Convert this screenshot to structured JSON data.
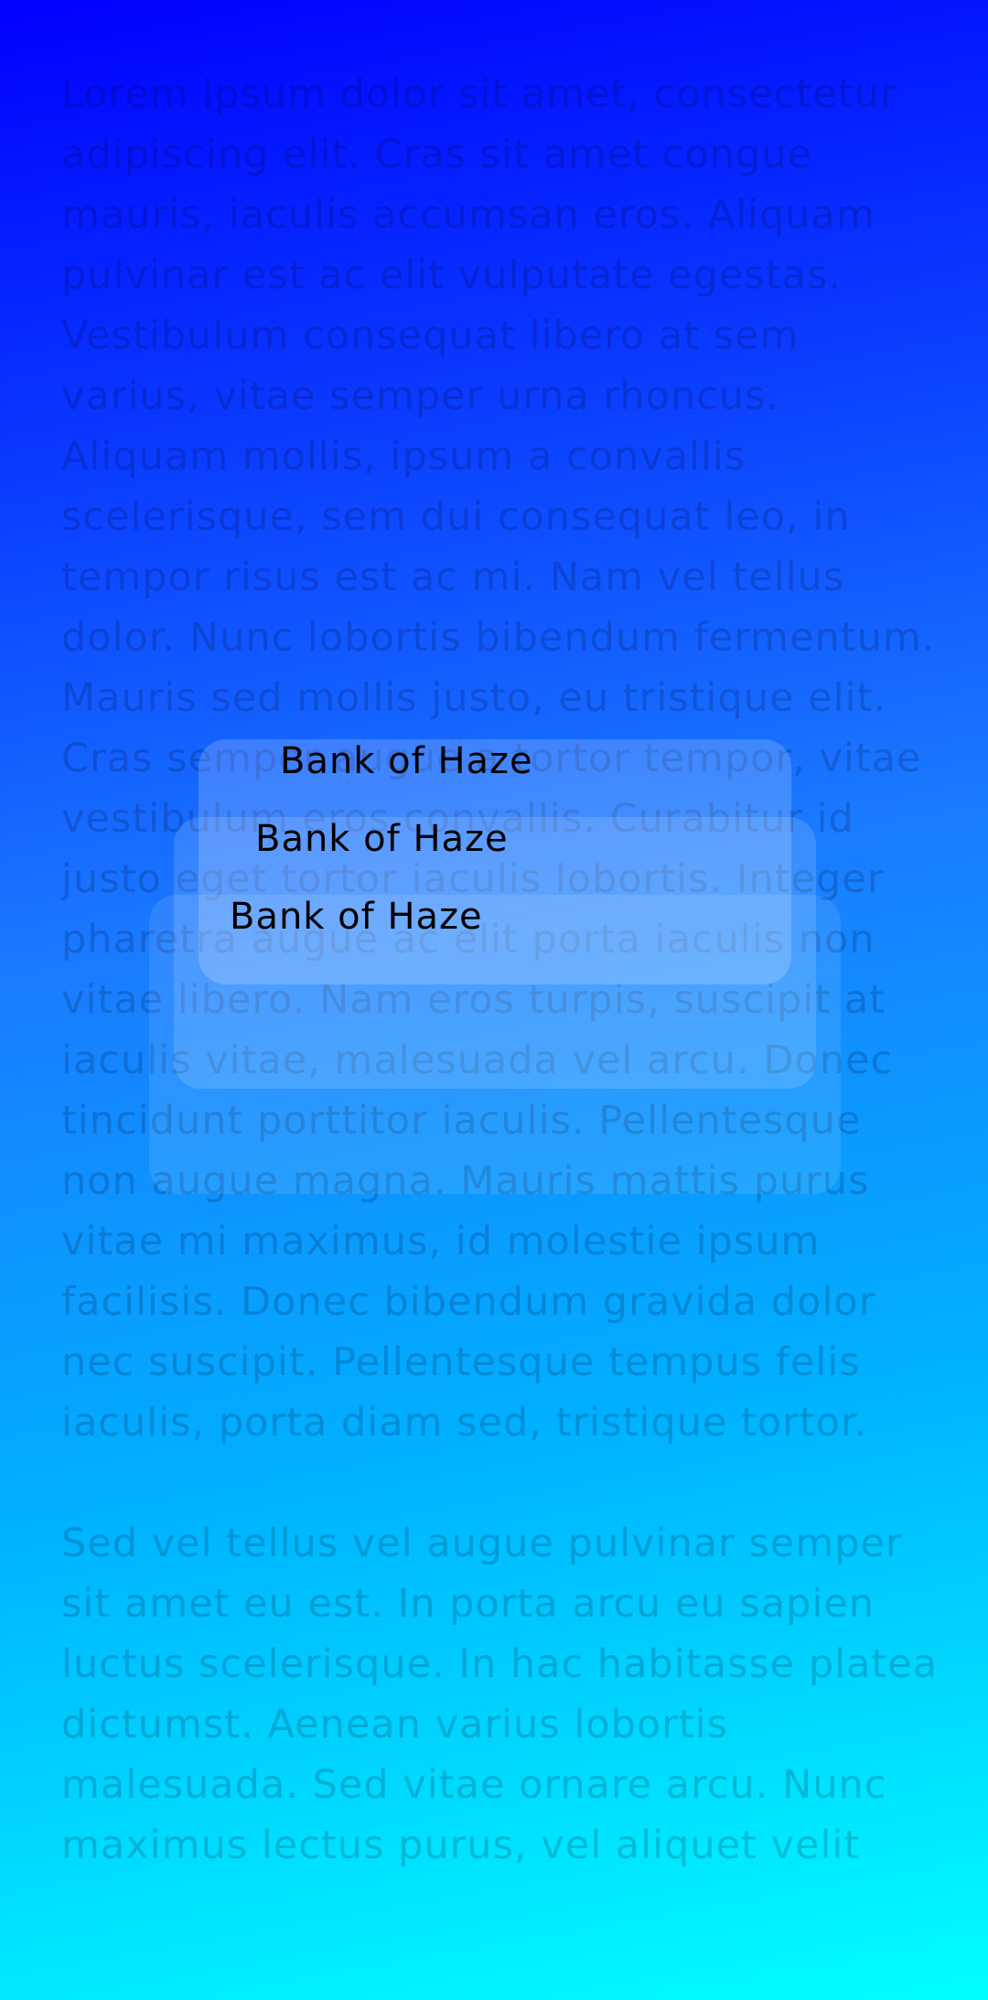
{
  "background": {
    "paragraphs": [
      "Lorem ipsum dolor sit amet, consectetur adipiscing elit. Cras sit amet congue mauris, iaculis accumsan eros. Aliquam pulvinar est ac elit vulputate egestas. Vestibulum consequat libero at sem varius, vitae semper urna rhoncus. Aliquam mollis, ipsum a convallis scelerisque, sem dui consequat leo, in tempor risus est ac mi. Nam vel tellus dolor. Nunc lobortis bibendum fermentum. Mauris sed mollis justo, eu tristique elit. Cras semper augue a tortor tempor, vitae vestibulum eros convallis. Curabitur id justo eget tortor iaculis lobortis. Integer pharetra augue ac elit porta iaculis non vitae libero. Nam eros turpis, suscipit at iaculis vitae, malesuada vel arcu. Donec tincidunt porttitor iaculis. Pellentesque non augue magna. Mauris mattis purus vitae mi maximus, id molestie ipsum facilisis. Donec bibendum gravida dolor nec suscipit. Pellentesque tempus felis iaculis, porta diam sed, tristique tortor.",
      "Sed vel tellus vel augue pulvinar semper sit amet eu est. In porta arcu eu sapien luctus scelerisque. In hac habitasse platea dictumst. Aenean varius lobortis malesuada. Sed vitae ornare arcu. Nunc maximus lectus purus, vel aliquet velit"
    ]
  },
  "cards": [
    {
      "title": "Bank of Haze"
    },
    {
      "title": "Bank of Haze"
    },
    {
      "title": "Bank of Haze"
    }
  ],
  "colors": {
    "gradient_top": "#0000ff",
    "gradient_bottom": "#00ffff",
    "card_title": "#000000"
  }
}
